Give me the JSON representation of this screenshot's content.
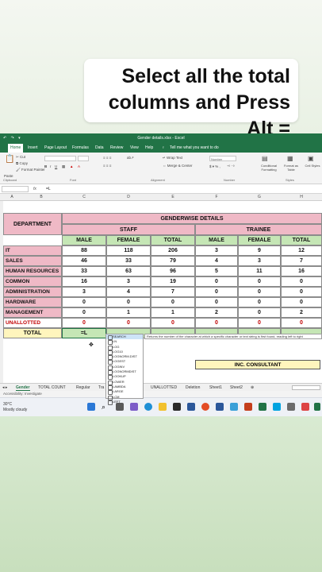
{
  "caption": {
    "line1": "Select all the total",
    "line2": "columns and Press Alt ="
  },
  "window": {
    "title": "Gender details.xlsx  -  Excel",
    "tabs": [
      "Home",
      "Insert",
      "Page Layout",
      "Formulas",
      "Data",
      "Review",
      "View",
      "Help",
      "Tell me what you want to do"
    ],
    "active_tab": "Home"
  },
  "ribbon": {
    "cut": "Cut",
    "copy": "Copy",
    "format_painter": "Format Painter",
    "clipboard": "Clipboard",
    "font": "Font",
    "alignment": "Alignment",
    "wrap_text": "Wrap Text",
    "merge_center": "Merge & Center",
    "number_format": "Number",
    "number": "Number",
    "conditional_formatting": "Conditional Formatting",
    "format_as_table": "Format as Table",
    "cell_styles": "Cell Styles",
    "styles": "Styles"
  },
  "formula_bar": {
    "fx": "fx",
    "content": "=L"
  },
  "columns": [
    "A",
    "B",
    "C",
    "D",
    "E",
    "F",
    "G",
    "H"
  ],
  "table": {
    "header_department": "DEPARTMENT",
    "header_details": "GENDERWISE DETAILS",
    "staff": "STAFF",
    "trainee": "TRAINEE",
    "sub_headers": [
      "MALE",
      "FEMALE",
      "TOTAL",
      "MALE",
      "FEMALE",
      "TOTAL"
    ],
    "rows": [
      {
        "dept": "IT",
        "values": [
          "88",
          "118",
          "206",
          "3",
          "9",
          "12"
        ]
      },
      {
        "dept": "SALES",
        "values": [
          "46",
          "33",
          "79",
          "4",
          "3",
          "7"
        ]
      },
      {
        "dept": "HUMAN RESOURCES",
        "values": [
          "33",
          "63",
          "96",
          "5",
          "11",
          "16"
        ]
      },
      {
        "dept": "COMMON",
        "values": [
          "16",
          "3",
          "19",
          "0",
          "0",
          "0"
        ]
      },
      {
        "dept": "ADMINISTRATION",
        "values": [
          "3",
          "4",
          "7",
          "0",
          "0",
          "0"
        ]
      },
      {
        "dept": "HARDWARE",
        "values": [
          "0",
          "0",
          "0",
          "0",
          "0",
          "0"
        ]
      },
      {
        "dept": "MANAGEMENT",
        "values": [
          "0",
          "1",
          "1",
          "2",
          "0",
          "2"
        ]
      },
      {
        "dept": "UNALLOTTED",
        "values": [
          "0",
          "0",
          "0",
          "0",
          "0",
          "0"
        ]
      }
    ],
    "total_label": "TOTAL",
    "total_entry": "=L"
  },
  "autocomplete": {
    "items": [
      "SEARCH",
      "LN",
      "LOG",
      "LOG10",
      "LOGNORM.DIST",
      "LOGEST",
      "LOGINV",
      "LOGNORMDIST",
      "LOOKUP",
      "LOWER",
      "LAMBDA",
      "LARGE",
      "LCM",
      "LEFT"
    ],
    "tooltip": "Returns the number of the character at which a specific character or text string is first found, reading left to right"
  },
  "inc_consultant": "INC. CONSULTANT",
  "sheet_tabs": [
    "Gender",
    "TOTAL COUNT",
    "Regular",
    "Tra",
    "UNALLOTTED",
    "Deletion",
    "Sheet1",
    "Sheet2"
  ],
  "active_sheet": "Gender",
  "status": "Accessibility: Investigate",
  "weather": {
    "temp": "30°C",
    "condition": "Mostly cloudy"
  }
}
